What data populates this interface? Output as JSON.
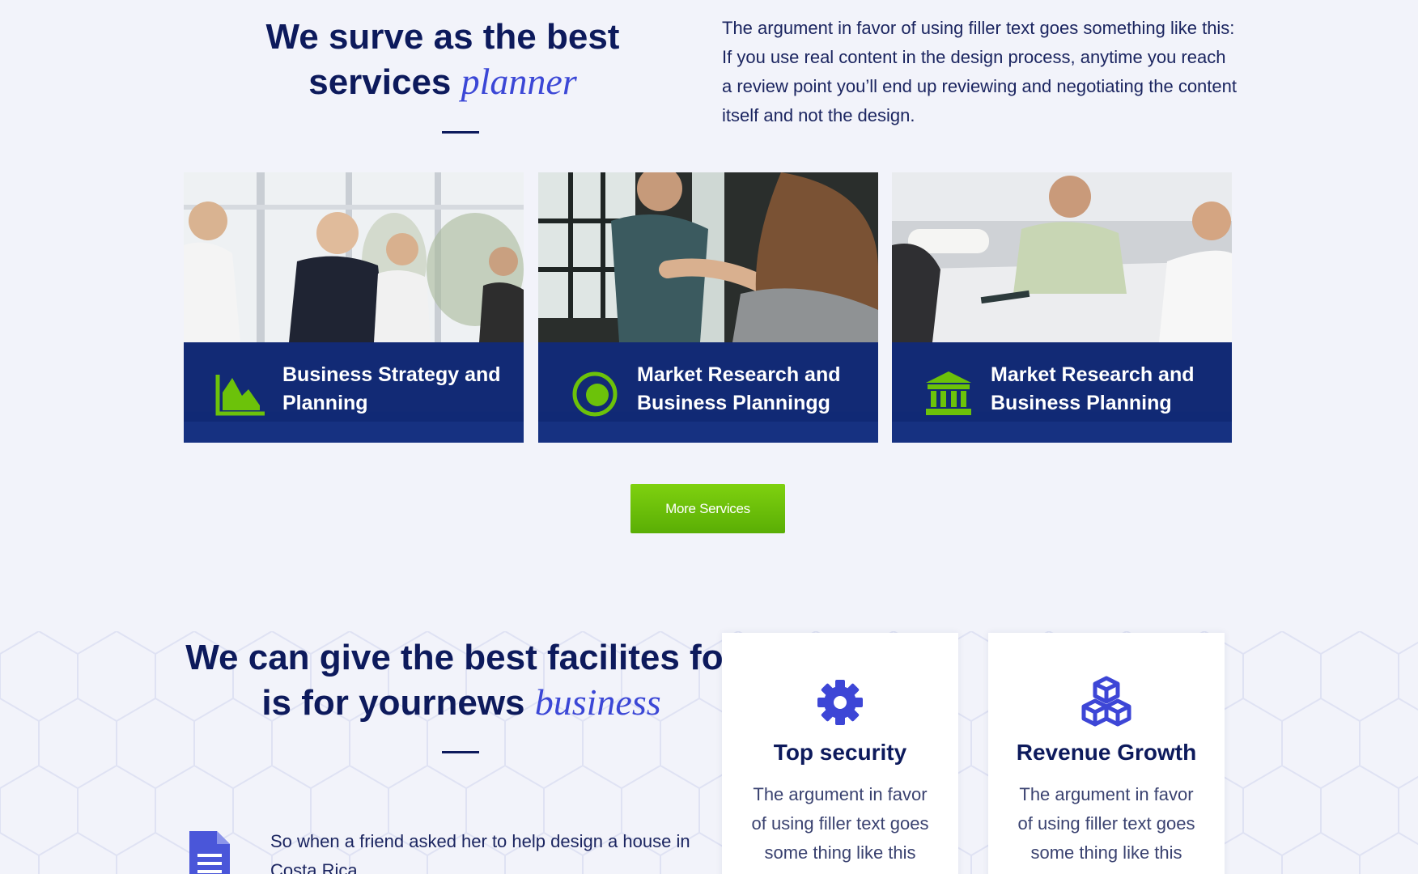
{
  "section_services": {
    "heading_main": "We surve as the best services ",
    "heading_em": "planner",
    "description": "The argument in favor of using filler text goes something like this: If you use real content in the design process, anytime you reach a review point you’ll end up reviewing and negotiating the content itself and not the design.",
    "cards": [
      {
        "title": "Business Strategy and Planning",
        "icon": "area-chart-icon"
      },
      {
        "title": "Market Research and Business Planningg",
        "icon": "target-icon"
      },
      {
        "title": "Market Research and Business Planning",
        "icon": "bank-icon"
      }
    ],
    "more_button": "More Services"
  },
  "section_facilities": {
    "heading_main": "We can give the best facilites for is for yournews ",
    "heading_em": "business",
    "text": "So when a friend asked her to help design a house in Costa Rica",
    "features": [
      {
        "title": "Top security",
        "text": "The argument in favor of using filler text goes some thing like this",
        "icon": "gear-icon"
      },
      {
        "title": "Revenue Growth",
        "text": "The argument in favor of using filler text goes some thing like this",
        "icon": "cubes-icon"
      }
    ]
  },
  "colors": {
    "navy": "#0d1a5c",
    "accent_blue": "#3b47d6",
    "green": "#6cc20a",
    "background": "#f2f3fa"
  }
}
